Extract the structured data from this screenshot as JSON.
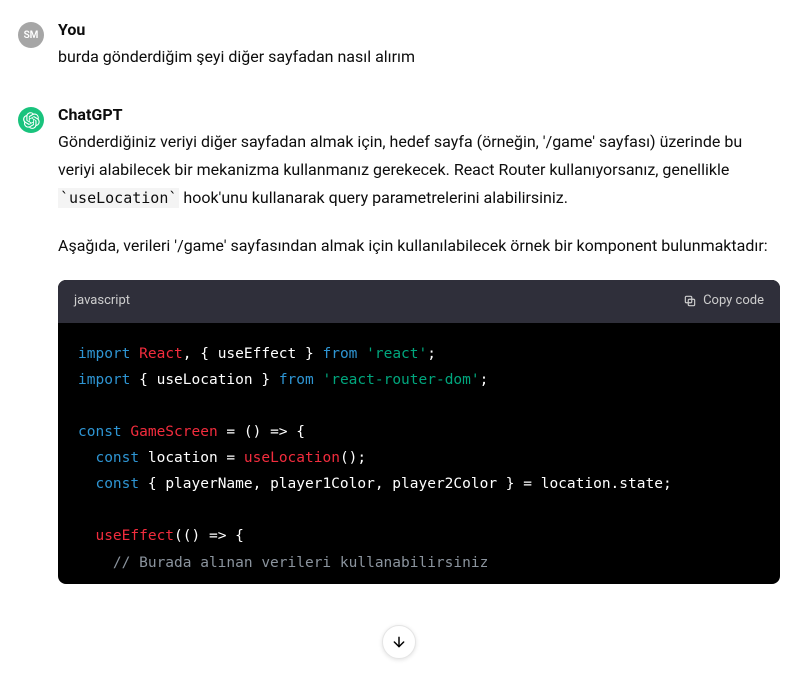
{
  "user": {
    "avatar_initials": "SM",
    "name": "You",
    "message": "burda gönderdiğim şeyi diğer sayfadan nasıl alırım"
  },
  "assistant": {
    "name": "ChatGPT",
    "paragraph1_pre": "Gönderdiğiniz veriyi diğer sayfadan almak için, hedef sayfa (örneğin, '/game' sayfası) üzerinde bu veriyi alabilecek bir mekanizma kullanmanız gerekecek. React Router kullanıyorsanız, genellikle ",
    "paragraph1_code": "`useLocation`",
    "paragraph1_post": " hook'unu kullanarak query parametrelerini alabilirsiniz.",
    "paragraph2": "Aşağıda, verileri '/game' sayfasından almak için kullanılabilecek örnek bir komponent bulunmaktadır:"
  },
  "code": {
    "language": "javascript",
    "copy_label": "Copy code",
    "tokens": {
      "import": "import",
      "from": "from",
      "const": "const",
      "React": "React",
      "useEffect_decl": "useEffect",
      "useLocation_decl": "useLocation",
      "react_str": "'react'",
      "rrd_str": "'react-router-dom'",
      "GameScreen": "GameScreen",
      "location": "location",
      "useLocation_call": "useLocation",
      "destructure": "{ playerName, player1Color, player2Color }",
      "location_state": "location.state",
      "useEffect_call": "useEffect",
      "arrow_empty": "(() => {",
      "comment": "// Burada alınan verileri kullanabilirsiniz"
    }
  },
  "icons": {
    "copy": "copy-icon",
    "assistant_logo": "openai-logo",
    "scroll_down": "arrow-down-icon"
  }
}
